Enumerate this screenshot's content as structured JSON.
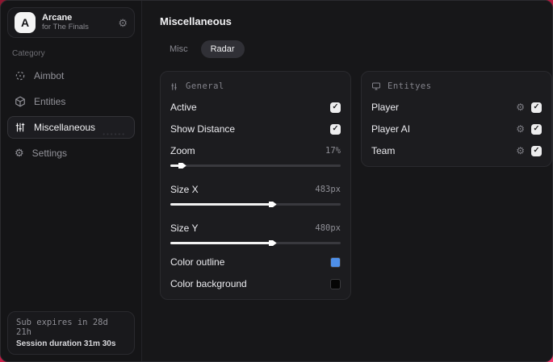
{
  "sidebar": {
    "logo_letter": "A",
    "app_name": "Arcane",
    "app_subtitle": "for The Finals",
    "header_gear_icon": "gear-icon",
    "category_label": "Category",
    "items": [
      {
        "label": "Aimbot",
        "icon": "crosshair-scan-icon",
        "active": false
      },
      {
        "label": "Entities",
        "icon": "cube-icon",
        "active": false
      },
      {
        "label": "Miscellaneous",
        "icon": "sliders-icon",
        "active": true
      },
      {
        "label": "Settings",
        "icon": "gear-icon",
        "active": false
      }
    ],
    "footer": {
      "line1": "Sub expires in 28d 21h",
      "line2": "Session duration 31m 30s"
    }
  },
  "main": {
    "title": "Miscellaneous",
    "tabs": [
      {
        "label": "Misc",
        "active": false
      },
      {
        "label": "Radar",
        "active": true
      }
    ],
    "general_card": {
      "title": "General",
      "title_icon": "sliders-icon",
      "toggles": [
        {
          "label": "Active",
          "checked": true,
          "checkmark": "✓"
        },
        {
          "label": "Show Distance",
          "checked": true,
          "checkmark": "✓"
        }
      ],
      "sliders": [
        {
          "label": "Zoom",
          "value": "17%",
          "pct": 7
        },
        {
          "label": "Size X",
          "value": "483px",
          "pct": 60
        },
        {
          "label": "Size Y",
          "value": "480px",
          "pct": 60
        }
      ],
      "colors": [
        {
          "label": "Color outline",
          "color": "#4e8fe8"
        },
        {
          "label": "Color background",
          "color": "#050505"
        }
      ]
    },
    "entities_card": {
      "title": "Entityes",
      "title_icon": "monitor-icon",
      "rows": [
        {
          "label": "Player",
          "checked": true,
          "checkmark": "✓",
          "gear_icon": "gear-icon"
        },
        {
          "label": "Player AI",
          "checked": true,
          "checkmark": "✓",
          "gear_icon": "gear-icon"
        },
        {
          "label": "Team",
          "checked": true,
          "checkmark": "✓",
          "gear_icon": "gear-icon"
        }
      ]
    }
  },
  "colors": {
    "backdrop_accent": "#c21c44",
    "window_bg": "#161618",
    "card_bg": "#1c1c1f",
    "outline_swatch": "#4e8fe8",
    "background_swatch": "#050505",
    "checkbox_bg": "#ededee"
  },
  "glyphs": {
    "gear": "⚙"
  }
}
